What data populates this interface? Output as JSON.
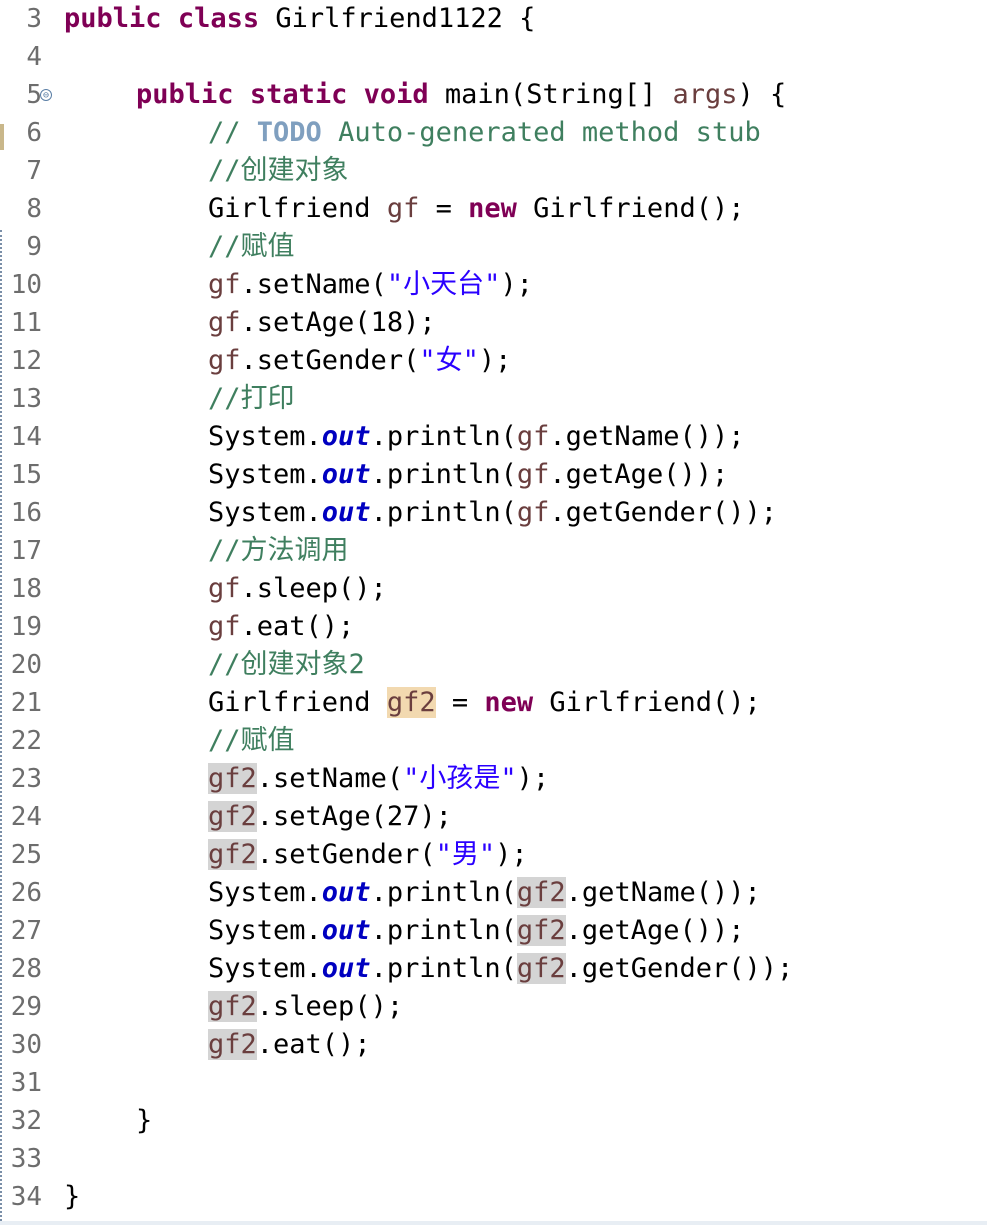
{
  "editor": {
    "lines": [
      {
        "n": "3"
      },
      {
        "n": "4"
      },
      {
        "n": "5"
      },
      {
        "n": "6"
      },
      {
        "n": "7"
      },
      {
        "n": "8"
      },
      {
        "n": "9"
      },
      {
        "n": "10"
      },
      {
        "n": "11"
      },
      {
        "n": "12"
      },
      {
        "n": "13"
      },
      {
        "n": "14"
      },
      {
        "n": "15"
      },
      {
        "n": "16"
      },
      {
        "n": "17"
      },
      {
        "n": "18"
      },
      {
        "n": "19"
      },
      {
        "n": "20"
      },
      {
        "n": "21"
      },
      {
        "n": "22"
      },
      {
        "n": "23"
      },
      {
        "n": "24"
      },
      {
        "n": "25"
      },
      {
        "n": "26"
      },
      {
        "n": "27"
      },
      {
        "n": "28"
      },
      {
        "n": "29"
      },
      {
        "n": "30"
      },
      {
        "n": "31"
      },
      {
        "n": "32"
      },
      {
        "n": "33"
      },
      {
        "n": "34"
      }
    ],
    "fold_glyph": "⊖",
    "tokens": {
      "public": "public",
      "class": "class",
      "static": "static",
      "void": "void",
      "new": "new",
      "class_name": " Girlfriend1122 {",
      "main_sig": " main(String[] ",
      "args": "args",
      "main_close": ") {",
      "todo_prefix": "// ",
      "todo": "TODO",
      "todo_rest": " Auto-generated method stub",
      "cmt_create": "//创建对象",
      "cmt_assign": "//赋值",
      "cmt_print": "//打印",
      "cmt_call": "//方法调用",
      "cmt_create2": "//创建对象2",
      "type": "Girlfriend ",
      "gf": "gf",
      "gf2": "gf2",
      "assign_new": " = ",
      "ctor": " Girlfriend();",
      "set_name": ".setName(",
      "set_age": ".setAge(",
      "set_gender": ".setGender(",
      "str_name1": "\"小天台\"",
      "str_gender1": "\"女\"",
      "str_name2": "\"小孩是\"",
      "str_gender2": "\"男\"",
      "age1": "18);",
      "age2": "27);",
      "close_stmt": ");",
      "system": "System.",
      "out": "out",
      "println": ".println(",
      "get_name": ".getName());",
      "get_age": ".getAge());",
      "get_gender": ".getGender());",
      "sleep": ".sleep();",
      "eat": ".eat();",
      "rbrace": "}"
    }
  }
}
